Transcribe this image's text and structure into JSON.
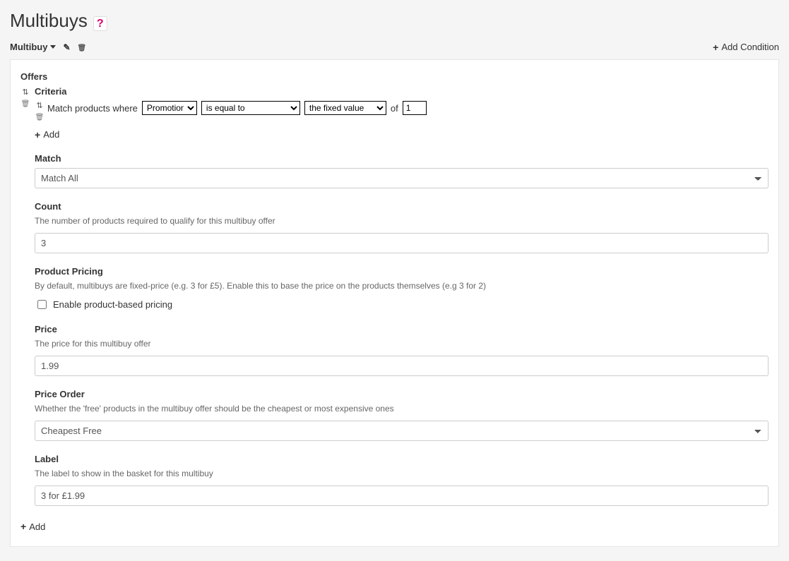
{
  "header": {
    "title": "Multibuys",
    "help_char": "?",
    "dropdown_label": "Multibuy",
    "add_condition_label": "Add Condition"
  },
  "offers": {
    "heading": "Offers",
    "criteria_heading": "Criteria",
    "rule": {
      "prefix": "Match products where",
      "field_options": [
        "Promotion"
      ],
      "field_value": "Promotion",
      "operator_options": [
        "is equal to"
      ],
      "operator_value": "is equal to",
      "value_type_options": [
        "the fixed value"
      ],
      "value_type_value": "the fixed value",
      "of_text": "of",
      "value": "1"
    },
    "add_label": "Add"
  },
  "match": {
    "label": "Match",
    "options": [
      "Match All"
    ],
    "value": "Match All"
  },
  "count": {
    "label": "Count",
    "help": "The number of products required to qualify for this multibuy offer",
    "value": "3"
  },
  "product_pricing": {
    "label": "Product Pricing",
    "help": "By default, multibuys are fixed-price (e.g. 3 for £5). Enable this to base the price on the products themselves (e.g 3 for 2)",
    "checkbox_label": "Enable product-based pricing",
    "checked": false
  },
  "price": {
    "label": "Price",
    "help": "The price for this multibuy offer",
    "value": "1.99"
  },
  "price_order": {
    "label": "Price Order",
    "help": "Whether the 'free' products in the multibuy offer should be the cheapest or most expensive ones",
    "options": [
      "Cheapest Free"
    ],
    "value": "Cheapest Free"
  },
  "label_field": {
    "label": "Label",
    "help": "The label to show in the basket for this multibuy",
    "value": "3 for £1.99"
  },
  "bottom_add": "Add"
}
